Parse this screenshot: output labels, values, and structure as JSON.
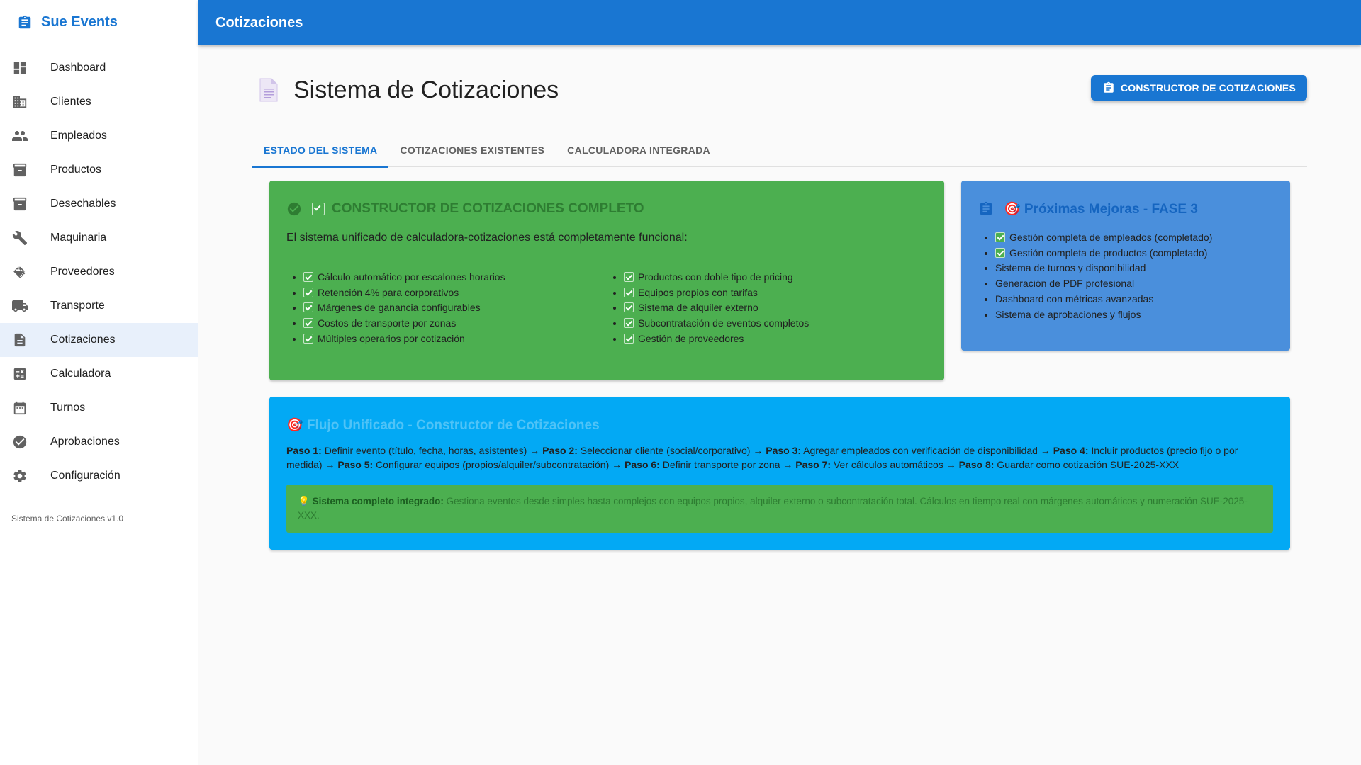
{
  "sidebar": {
    "brand": "Sue Events",
    "items": [
      {
        "label": "Dashboard",
        "icon": "dashboard-icon"
      },
      {
        "label": "Clientes",
        "icon": "building-icon"
      },
      {
        "label": "Empleados",
        "icon": "people-icon"
      },
      {
        "label": "Productos",
        "icon": "archive-icon"
      },
      {
        "label": "Desechables",
        "icon": "archive-icon"
      },
      {
        "label": "Maquinaria",
        "icon": "wrench-icon"
      },
      {
        "label": "Proveedores",
        "icon": "handshake-icon"
      },
      {
        "label": "Transporte",
        "icon": "truck-icon"
      },
      {
        "label": "Cotizaciones",
        "icon": "document-icon",
        "active": true
      },
      {
        "label": "Calculadora",
        "icon": "calculator-icon"
      },
      {
        "label": "Turnos",
        "icon": "calendar-icon"
      },
      {
        "label": "Aprobaciones",
        "icon": "check-circle-icon"
      },
      {
        "label": "Configuración",
        "icon": "gear-icon"
      }
    ],
    "footer": "Sistema de Cotizaciones v1.0"
  },
  "appbar": {
    "title": "Cotizaciones"
  },
  "page": {
    "title": "Sistema de Cotizaciones",
    "builder_button": "CONSTRUCTOR DE COTIZACIONES"
  },
  "tabs": [
    {
      "label": "ESTADO DEL SISTEMA",
      "active": true
    },
    {
      "label": "COTIZACIONES EXISTENTES"
    },
    {
      "label": "CALCULADORA INTEGRADA"
    }
  ],
  "status_card": {
    "title": "CONSTRUCTOR DE COTIZACIONES COMPLETO",
    "intro": "El sistema unificado de calculadora-cotizaciones está completamente funcional:",
    "left_items": [
      "Cálculo automático por escalones horarios",
      "Retención 4% para corporativos",
      "Márgenes de ganancia configurables",
      "Costos de transporte por zonas",
      "Múltiples operarios por cotización"
    ],
    "right_items": [
      "Productos con doble tipo de pricing",
      "Equipos propios con tarifas",
      "Sistema de alquiler externo",
      "Subcontratación de eventos completos",
      "Gestión de proveedores"
    ]
  },
  "improvements_card": {
    "title": "🎯 Próximas Mejoras - FASE 3",
    "items": [
      {
        "text": "Gestión completa de empleados (completado)",
        "checked": true
      },
      {
        "text": "Gestión completa de productos (completado)",
        "checked": true
      },
      {
        "text": "Sistema de turnos y disponibilidad"
      },
      {
        "text": "Generación de PDF profesional"
      },
      {
        "text": "Dashboard con métricas avanzadas"
      },
      {
        "text": "Sistema de aprobaciones y flujos"
      }
    ]
  },
  "flow_card": {
    "title": "🎯 Flujo Unificado - Constructor de Cotizaciones",
    "steps": [
      {
        "label": "Paso 1:",
        "text": " Definir evento (título, fecha, horas, asistentes) →"
      },
      {
        "label": "Paso 2:",
        "text": " Seleccionar cliente (social/corporativo) →"
      },
      {
        "label": "Paso 3:",
        "text": " Agregar empleados con verificación de disponibilidad →"
      },
      {
        "label": "Paso 4:",
        "text": " Incluir productos (precio fijo o por medida) →"
      },
      {
        "label": "Paso 5:",
        "text": " Configurar equipos (propios/alquiler/subcontratación) →"
      },
      {
        "label": "Paso 6:",
        "text": " Definir transporte por zona →"
      },
      {
        "label": "Paso 7:",
        "text": " Ver cálculos automáticos →"
      },
      {
        "label": "Paso 8:",
        "text": " Guardar como cotización SUE-2025-XXX"
      }
    ],
    "tip_icon": "💡",
    "tip_label": "Sistema completo integrado:",
    "tip_text": " Gestiona eventos desde simples hasta complejos con equipos propios, alquiler externo o subcontratación total. Cálculos en tiempo real con márgenes automáticos y numeración SUE-2025-XXX."
  },
  "colors": {
    "primary": "#1976d2",
    "status_green": "#4caf50",
    "improvements_blue": "#4a8fdc",
    "flow_cyan": "#03a9f4"
  }
}
